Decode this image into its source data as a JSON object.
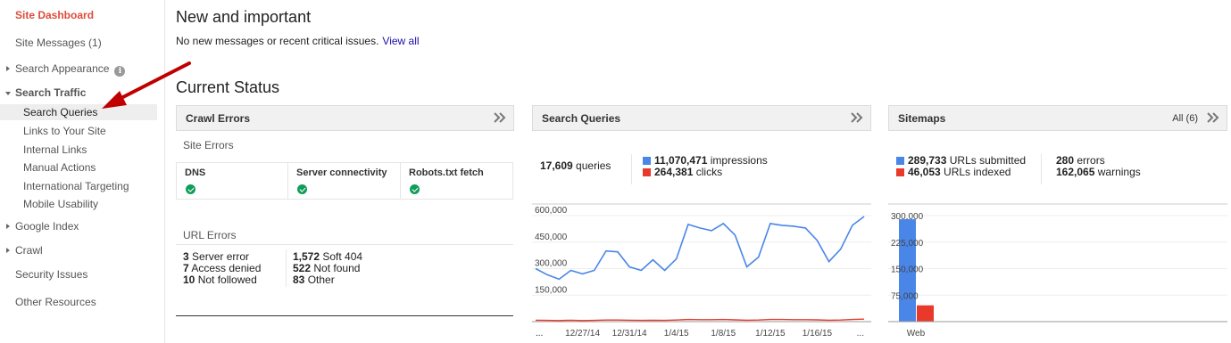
{
  "sidebar": {
    "items": [
      {
        "label": "Site Dashboard"
      },
      {
        "label": "Site Messages (1)"
      },
      {
        "label": "Search Appearance"
      },
      {
        "label": "Search Traffic"
      },
      {
        "label": "Search Queries"
      },
      {
        "label": "Links to Your Site"
      },
      {
        "label": "Internal Links"
      },
      {
        "label": "Manual Actions"
      },
      {
        "label": "International Targeting"
      },
      {
        "label": "Mobile Usability"
      },
      {
        "label": "Google Index"
      },
      {
        "label": "Crawl"
      },
      {
        "label": "Security Issues"
      },
      {
        "label": "Other Resources"
      }
    ],
    "info_glyph": "i"
  },
  "main": {
    "heading": "New and important",
    "notice_text": "No new messages or recent critical issues.",
    "notice_link": "View all",
    "status_heading": "Current Status"
  },
  "crawl_errors": {
    "title": "Crawl Errors",
    "site_errors_label": "Site Errors",
    "site_errors": [
      {
        "label": "DNS",
        "status": "ok"
      },
      {
        "label": "Server connectivity",
        "status": "ok"
      },
      {
        "label": "Robots.txt fetch",
        "status": "ok"
      }
    ],
    "url_errors_label": "URL Errors",
    "url_errors_left": [
      {
        "count": "3",
        "label": "Server error"
      },
      {
        "count": "7",
        "label": "Access denied"
      },
      {
        "count": "10",
        "label": "Not followed"
      }
    ],
    "url_errors_right": [
      {
        "count": "1,572",
        "label": "Soft 404"
      },
      {
        "count": "522",
        "label": "Not found"
      },
      {
        "count": "83",
        "label": "Other"
      }
    ]
  },
  "search_queries": {
    "title": "Search Queries",
    "queries_count": "17,609",
    "queries_label": "queries",
    "impressions_count": "11,070,471",
    "impressions_label": "impressions",
    "clicks_count": "264,381",
    "clicks_label": "clicks",
    "impressions_color": "#4a86e8",
    "clicks_color": "#e8392a"
  },
  "sitemaps": {
    "title": "Sitemaps",
    "all_label": "All (6)",
    "submitted_count": "289,733",
    "submitted_label": "URLs submitted",
    "indexed_count": "46,053",
    "indexed_label": "URLs indexed",
    "errors_count": "280",
    "errors_label": "errors",
    "warnings_count": "162,065",
    "warnings_label": "warnings",
    "submitted_color": "#4a86e8",
    "indexed_color": "#e8392a"
  },
  "chart_data": [
    {
      "type": "line",
      "x": [
        "...",
        "12/24/14",
        "12/25/14",
        "12/26/14",
        "12/27/14",
        "12/28/14",
        "12/29/14",
        "12/30/14",
        "12/31/14",
        "1/1/15",
        "1/2/15",
        "1/3/15",
        "1/4/15",
        "1/5/15",
        "1/6/15",
        "1/7/15",
        "1/8/15",
        "1/9/15",
        "1/10/15",
        "1/11/15",
        "1/12/15",
        "1/13/15",
        "1/14/15",
        "1/15/15",
        "1/16/15",
        "1/17/15",
        "1/18/15",
        "1/19/15",
        "..."
      ],
      "x_tick_labels": [
        "...",
        "12/27/14",
        "12/31/14",
        "1/4/15",
        "1/8/15",
        "1/12/15",
        "1/16/15",
        "..."
      ],
      "series": [
        {
          "name": "impressions",
          "values": [
            300000,
            265000,
            240000,
            290000,
            270000,
            290000,
            400000,
            395000,
            310000,
            290000,
            350000,
            290000,
            355000,
            550000,
            530000,
            515000,
            555000,
            490000,
            310000,
            365000,
            555000,
            545000,
            540000,
            530000,
            460000,
            340000,
            410000,
            545000,
            595000
          ]
        },
        {
          "name": "clicks",
          "values": [
            8000,
            7000,
            6000,
            8000,
            6000,
            7000,
            9000,
            9000,
            8000,
            7000,
            8000,
            7000,
            9000,
            12000,
            11000,
            11000,
            12000,
            10000,
            8000,
            9000,
            12000,
            12000,
            11000,
            11000,
            10000,
            8000,
            9000,
            12000,
            14000
          ]
        }
      ],
      "y_ticks": [
        "150,000",
        "300,000",
        "450,000",
        "600,000"
      ],
      "ylim": [
        0,
        600000
      ]
    },
    {
      "type": "bar",
      "categories": [
        "Web"
      ],
      "series": [
        {
          "name": "URLs submitted",
          "values": [
            289733
          ]
        },
        {
          "name": "URLs indexed",
          "values": [
            46053
          ]
        }
      ],
      "y_ticks": [
        "75,000",
        "150,000",
        "225,000",
        "300,000"
      ],
      "ylim": [
        0,
        300000
      ]
    }
  ]
}
